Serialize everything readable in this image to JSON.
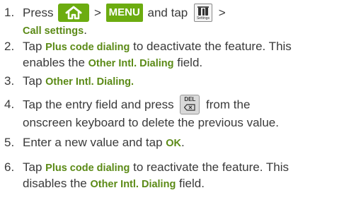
{
  "steps": [
    {
      "num": "1.",
      "t1": "Press",
      "t2": ">",
      "menu_key": "MENU",
      "t3": "and tap",
      "settings_icon_label": "Settings",
      "t4": ">",
      "t5": "Call settings",
      "t6": "."
    },
    {
      "num": "2.",
      "t1": "Tap",
      "em1": "Plus code dialing",
      "t2": "to deactivate the feature. This",
      "t3": "enables the",
      "em2": "Other Intl. Dialing",
      "t4": "field."
    },
    {
      "num": "3.",
      "t1": "Tap",
      "em1": "Other Intl. Dialing."
    },
    {
      "num": "4.",
      "t1": "Tap the entry field and press",
      "del_key": "DEL",
      "t2": "from the",
      "t3": "onscreen keyboard to delete the previous value."
    },
    {
      "num": "5.",
      "t1": "Enter a new value and tap",
      "em1": "OK",
      "t2": "."
    },
    {
      "num": "6.",
      "t1": "Tap",
      "em1": "Plus code dialing",
      "t2": "to reactivate the feature. This",
      "t3": "disables the",
      "em2": "Other Intl. Dialing",
      "t4": "field."
    }
  ],
  "colors": {
    "accent": "#6cac10",
    "emphasis": "#5b8a16",
    "text": "#3a3a3a"
  },
  "icons": [
    "home-key-icon",
    "settings-icon",
    "delete-key-icon"
  ]
}
